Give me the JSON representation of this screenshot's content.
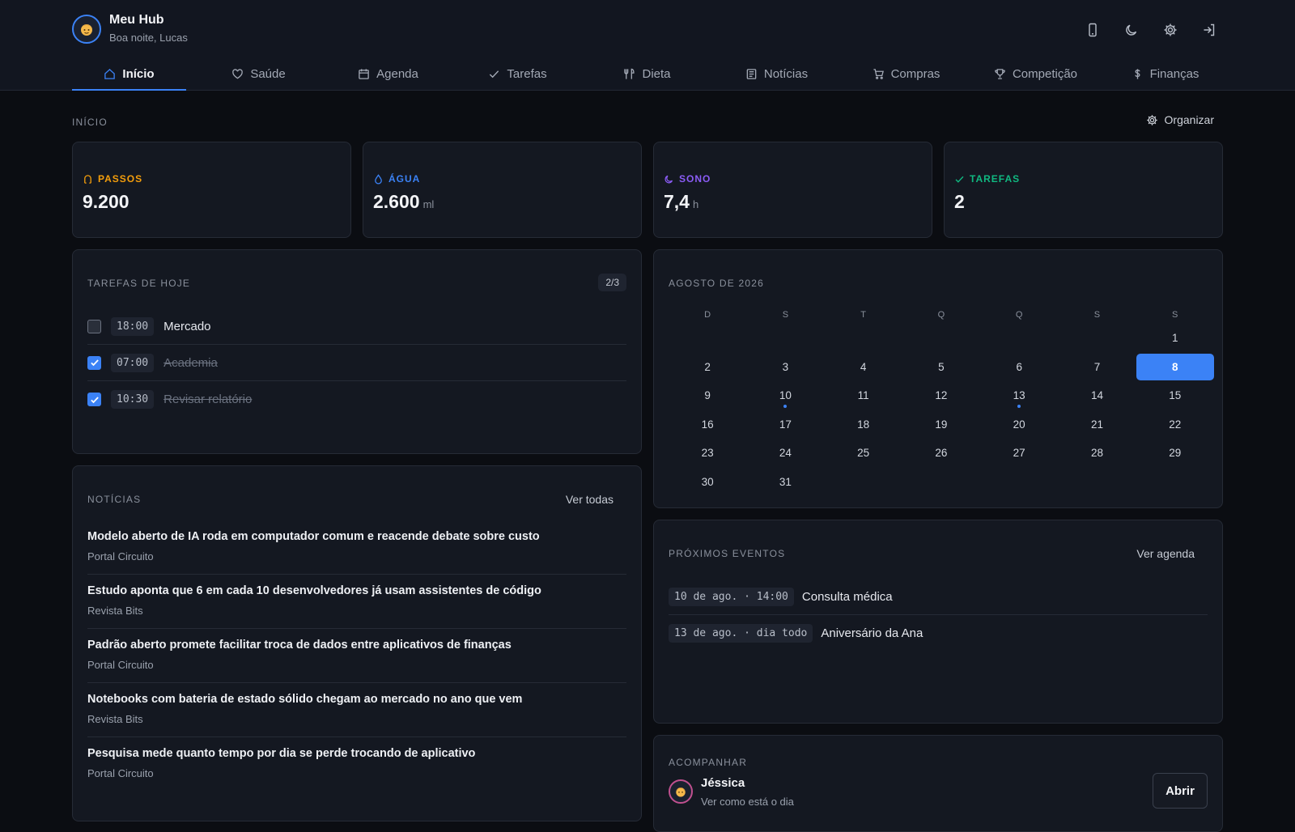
{
  "header": {
    "title": "Meu Hub",
    "subtitle": "Boa noite, Lucas",
    "avatar_icon": "person-face-icon",
    "actions": [
      "phone-icon",
      "moon-icon",
      "gear-icon",
      "logout-icon"
    ]
  },
  "nav": {
    "tabs": [
      {
        "label": "Início",
        "icon": "home-icon",
        "active": true
      },
      {
        "label": "Saúde",
        "icon": "heart-icon"
      },
      {
        "label": "Agenda",
        "icon": "calendar-icon"
      },
      {
        "label": "Tarefas",
        "icon": "check-icon"
      },
      {
        "label": "Dieta",
        "icon": "utensils-icon"
      },
      {
        "label": "Notícias",
        "icon": "newspaper-icon"
      },
      {
        "label": "Compras",
        "icon": "cart-icon"
      },
      {
        "label": "Competição",
        "icon": "trophy-icon"
      },
      {
        "label": "Finanças",
        "icon": "dollar-icon"
      }
    ]
  },
  "section": {
    "label": "INÍCIO",
    "organize_label": "Organizar"
  },
  "stats": [
    {
      "label": "PASSOS",
      "value": "9.200",
      "unit": "",
      "color": "#f59e0b",
      "icon": "footprint-icon"
    },
    {
      "label": "ÁGUA",
      "value": "2.600",
      "unit": "ml",
      "color": "#3b82f6",
      "icon": "droplet-icon"
    },
    {
      "label": "SONO",
      "value": "7,4",
      "unit": "h",
      "color": "#8b5cf6",
      "icon": "moon-icon"
    },
    {
      "label": "TAREFAS",
      "value": "2",
      "unit": "",
      "color": "#10b981",
      "icon": "check-icon"
    }
  ],
  "tasks": {
    "title": "TAREFAS DE HOJE",
    "count": "2/3",
    "items": [
      {
        "time": "18:00",
        "text": "Mercado",
        "done": false
      },
      {
        "time": "07:00",
        "text": "Academia",
        "done": true
      },
      {
        "time": "10:30",
        "text": "Revisar relatório",
        "done": true
      }
    ]
  },
  "calendar": {
    "title": "AGOSTO DE 2026",
    "weekdays": [
      "D",
      "S",
      "T",
      "Q",
      "Q",
      "S",
      "S"
    ],
    "weeks": [
      [
        "",
        "",
        "",
        "",
        "",
        "",
        "1"
      ],
      [
        "2",
        "3",
        "4",
        "5",
        "6",
        "7",
        "8"
      ],
      [
        "9",
        "10",
        "11",
        "12",
        "13",
        "14",
        "15"
      ],
      [
        "16",
        "17",
        "18",
        "19",
        "20",
        "21",
        "22"
      ],
      [
        "23",
        "24",
        "25",
        "26",
        "27",
        "28",
        "29"
      ],
      [
        "30",
        "31",
        "",
        "",
        "",
        "",
        ""
      ]
    ],
    "selected": "8",
    "event_days": [
      "10",
      "13"
    ]
  },
  "news": {
    "title": "NOTÍCIAS",
    "link": "Ver todas",
    "items": [
      {
        "title": "Modelo aberto de IA roda em computador comum e reacende debate sobre custo",
        "source": "Portal Circuito"
      },
      {
        "title": "Estudo aponta que 6 em cada 10 desenvolvedores já usam assistentes de código",
        "source": "Revista Bits"
      },
      {
        "title": "Padrão aberto promete facilitar troca de dados entre aplicativos de finanças",
        "source": "Portal Circuito"
      },
      {
        "title": "Notebooks com bateria de estado sólido chegam ao mercado no ano que vem",
        "source": "Revista Bits"
      },
      {
        "title": "Pesquisa mede quanto tempo por dia se perde trocando de aplicativo",
        "source": "Portal Circuito"
      }
    ]
  },
  "events": {
    "title": "PRÓXIMOS EVENTOS",
    "link": "Ver agenda",
    "items": [
      {
        "when": "10 de ago. · 14:00",
        "text": "Consulta médica"
      },
      {
        "when": "13 de ago. · dia todo",
        "text": "Aniversário da Ana"
      }
    ]
  },
  "follow": {
    "title": "ACOMPANHAR",
    "name": "Jéssica",
    "subtitle": "Ver como está o dia",
    "button": "Abrir",
    "avatar_icon": "person-face-icon"
  }
}
